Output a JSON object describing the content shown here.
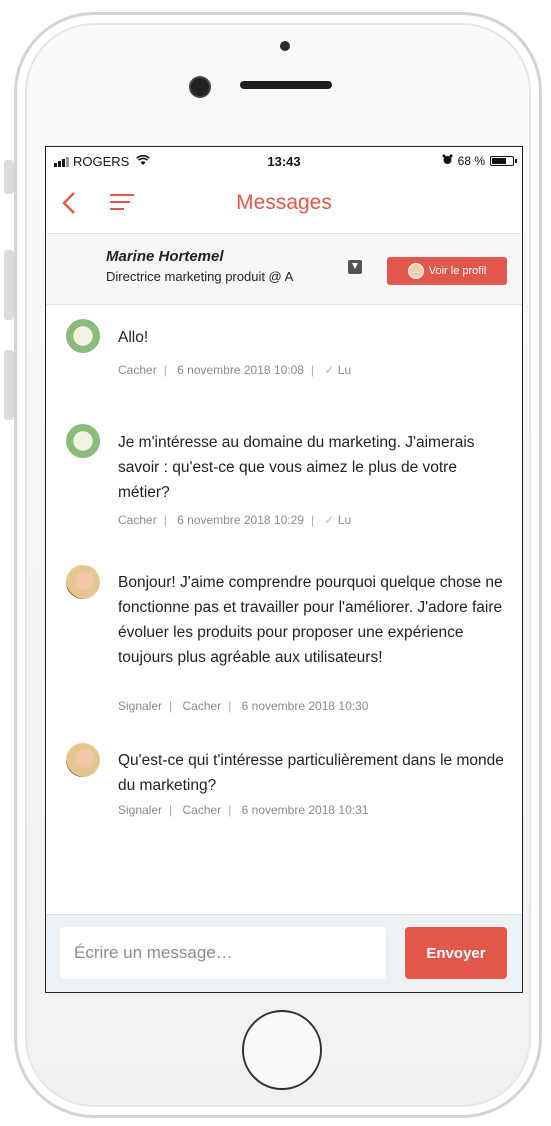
{
  "status_bar": {
    "carrier": "ROGERS",
    "time": "13:43",
    "battery": "68 %"
  },
  "nav": {
    "title": "Messages"
  },
  "contact": {
    "name": "Marine Hortemel",
    "subtitle": "Directrice marketing produit @ A",
    "profile_button": "Voir le profil"
  },
  "messages": [
    {
      "sender": "other",
      "text": "Allo!",
      "actions": [
        "Cacher"
      ],
      "date": "6 novembre 2018 10:08",
      "read": "Lu"
    },
    {
      "sender": "other",
      "text": "Je m'intéresse au domaine du marketing. J'aimerais savoir : qu'est-ce que vous aimez le plus de votre métier?",
      "actions": [
        "Cacher"
      ],
      "date": "6 novembre 2018 10:29",
      "read": "Lu"
    },
    {
      "sender": "contact",
      "text": "Bonjour! J'aime comprendre pourquoi quelque chose ne fonctionne pas et travailler pour l'améliorer. J'adore faire évoluer les produits pour proposer une expérience toujours plus agréable aux utilisateurs!",
      "actions": [
        "Signaler",
        "Cacher"
      ],
      "date": "6 novembre 2018 10:30",
      "read": ""
    },
    {
      "sender": "contact",
      "text": "Qu'est-ce qui t'intéresse particulièrement dans le monde du marketing?",
      "actions": [
        "Signaler",
        "Cacher"
      ],
      "date": "6 novembre 2018 10:31",
      "read": ""
    }
  ],
  "compose": {
    "placeholder": "Écrire un message…",
    "send_label": "Envoyer"
  },
  "colors": {
    "accent": "#e2574c"
  }
}
